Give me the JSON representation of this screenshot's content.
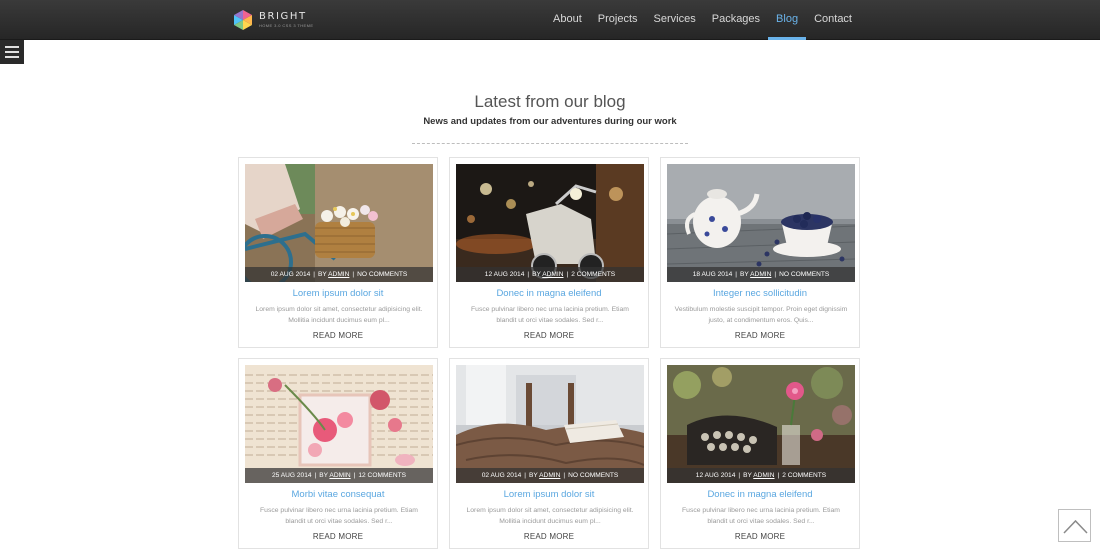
{
  "brand": {
    "name": "BRIGHT",
    "tagline": "HOME 3.0 CSS 3 THEME"
  },
  "nav": {
    "items": [
      {
        "label": "About",
        "active": false
      },
      {
        "label": "Projects",
        "active": false
      },
      {
        "label": "Services",
        "active": false
      },
      {
        "label": "Packages",
        "active": false
      },
      {
        "label": "Blog",
        "active": true
      },
      {
        "label": "Contact",
        "active": false
      }
    ],
    "accent_color": "#6ab3ea"
  },
  "menu_toggle": {
    "icon": "hamburger-icon"
  },
  "section": {
    "title": "Latest from our blog",
    "subtitle": "News and updates from our adventures during our work"
  },
  "posts": [
    {
      "date": "02 AUG 2014",
      "by": "BY",
      "author": "ADMIN",
      "comments": "NO COMMENTS",
      "title": "Lorem ipsum dolor sit",
      "excerpt": "Lorem ipsum dolor sit amet, consectetur adipisicing elit. Mollitia incidunt ducimus eum pl...",
      "read_more": "READ MORE",
      "image": "bicycle-basket-flowers"
    },
    {
      "date": "12 AUG 2014",
      "by": "BY",
      "author": "ADMIN",
      "comments": "2 COMMENTS",
      "title": "Donec in magna eleifend",
      "excerpt": "Fusce pulvinar libero nec urna lacinia pretium. Etiam blandit ut orci vitae sodales. Sed r...",
      "read_more": "READ MORE",
      "image": "scooter-night-street"
    },
    {
      "date": "18 AUG 2014",
      "by": "BY",
      "author": "ADMIN",
      "comments": "NO COMMENTS",
      "title": "Integer nec sollicitudin",
      "excerpt": "Vestibulum molestie suscipit tempor. Proin eget dignissim justo, at condimentum eros. Quis...",
      "read_more": "READ MORE",
      "image": "teapot-blueberries"
    },
    {
      "date": "25 AUG 2014",
      "by": "BY",
      "author": "ADMIN",
      "comments": "12 COMMENTS",
      "title": "Morbi vitae consequat",
      "excerpt": "Fusce pulvinar libero nec urna lacinia pretium. Etiam blandit ut orci vitae sodales. Sed r...",
      "read_more": "READ MORE",
      "image": "book-roses"
    },
    {
      "date": "02 AUG 2014",
      "by": "BY",
      "author": "ADMIN",
      "comments": "NO COMMENTS",
      "title": "Lorem ipsum dolor sit",
      "excerpt": "Lorem ipsum dolor sit amet, consectetur adipisicing elit. Mollitia incidunt ducimus eum pl...",
      "read_more": "READ MORE",
      "image": "blanket-chair-book"
    },
    {
      "date": "12 AUG 2014",
      "by": "BY",
      "author": "ADMIN",
      "comments": "2 COMMENTS",
      "title": "Donec in magna eleifend",
      "excerpt": "Fusce pulvinar libero nec urna lacinia pretium. Etiam blandit ut orci vitae sodales. Sed r...",
      "read_more": "READ MORE",
      "image": "typewriter-flower"
    }
  ],
  "back_to_top": {
    "icon": "chevron-up-icon"
  },
  "colors": {
    "topbar": "#2f2f2f",
    "link": "#5aa7e0",
    "text": "#444444"
  }
}
